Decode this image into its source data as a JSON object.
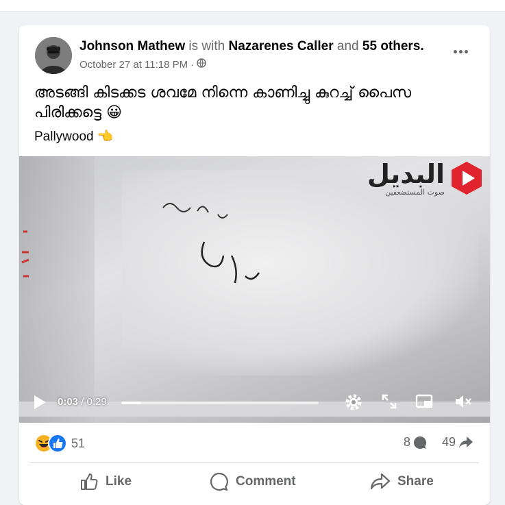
{
  "post": {
    "author": "Johnson Mathew",
    "with_connector": "is with",
    "tagged": "Nazarenes Caller",
    "and_connector": "and",
    "others": "55 others.",
    "timestamp": "October 27 at 11:18 PM",
    "separator": "·",
    "text_line1": "അടങ്ങി കിടക്കട ശവമേ നിന്നെ കാണിച്ചു കുറച്ച് പൈസ",
    "text_line2": "പിരിക്കട്ടെ 😀",
    "text_line3": "Pallywood 👈"
  },
  "video": {
    "watermark_main": "البديل",
    "watermark_sub": "صوت المستضعفين",
    "current_time": "0:03",
    "time_separator": " / ",
    "duration": "0:29",
    "progress_fraction": 0.1
  },
  "stats": {
    "reaction_count": "51",
    "comment_count": "8",
    "share_count": "49"
  },
  "actions": {
    "like": "Like",
    "comment": "Comment",
    "share": "Share"
  },
  "colors": {
    "background": "#f0f2f5",
    "card": "#ffffff",
    "muted_text": "#65676b",
    "like_blue": "#1877f2",
    "haha_yellow": "#f7b125",
    "watermark_red": "#e0232c"
  }
}
